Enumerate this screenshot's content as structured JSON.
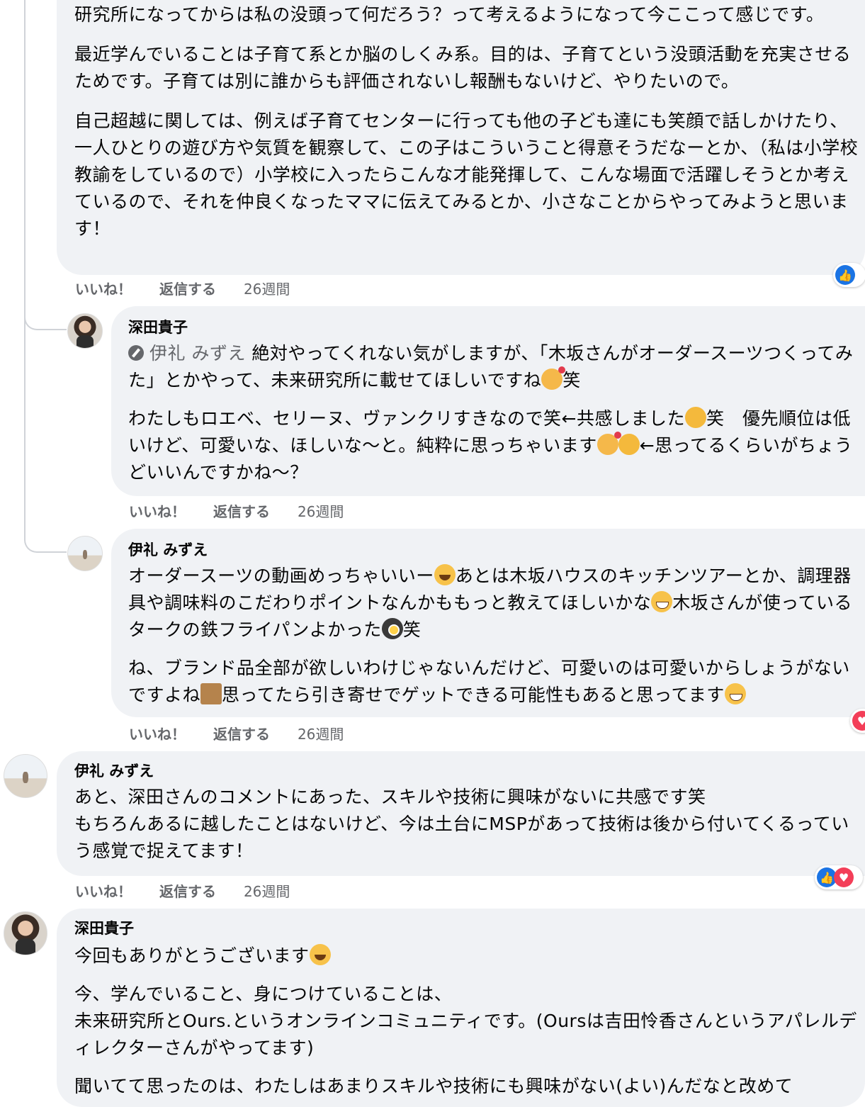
{
  "comments": [
    {
      "id": "c1",
      "paragraphs": [
        "研究所になってからは私の没頭って何だろう？って考えるようになって今ここって感じです。",
        "最近学んでいることは子育て系とか脳のしくみ系。目的は、子育てという没頭活動を充実させるためです。子育ては別に誰からも評価されないし報酬もないけど、やりたいので。",
        "自己超越に関しては、例えば子育てセンターに行っても他の子ども達にも笑顔で話しかけたり、一人ひとりの遊び方や気質を観察して、この子はこういうこと得意そうだなーとか、（私は小学校教諭をしているので）小学校に入ったらこんな才能発揮して、こんな場面で活躍しそうとか考えているので、それを仲良くなったママに伝えてみるとか、小さなことからやってみようと思います！"
      ],
      "actions": {
        "like": "いいね！",
        "reply": "返信する",
        "time": "26週間"
      }
    },
    {
      "id": "c2",
      "author": "深田貴子",
      "mention": "伊礼 みずえ",
      "p1_rest": " 絶対やってくれない気がしますが、「木坂さんがオーダースーツつくってみた」とかやって、未来研究所に載せてほしいですね",
      "p1_tail": "笑",
      "p2_a": "わたしもロエベ、セリーヌ、ヴァンクリすきなので笑←共感しました",
      "p2_b": "笑　優先順位は低いけど、可愛いな、ほしいな〜と。純粋に思っちゃいます",
      "p2_c": "←思ってるくらいがちょうどいいんですかね〜？",
      "actions": {
        "like": "いいね！",
        "reply": "返信する",
        "time": "26週間"
      }
    },
    {
      "id": "c3",
      "author": "伊礼 みずえ",
      "p1_a": "オーダースーツの動画めっちゃいいー",
      "p1_b": "あとは木坂ハウスのキッチンツアーとか、調理器具や調味料のこだわりポイントなんかももっと教えてほしいかな",
      "p1_c": "木坂さんが使っているタークの鉄フライパンよかった",
      "p1_d": "笑",
      "p2_a": "ね、ブランド品全部が欲しいわけじゃないんだけど、可愛いのは可愛いからしょうがないですよね",
      "p2_b": "思ってたら引き寄せでゲットできる可能性もあると思ってます",
      "actions": {
        "like": "いいね！",
        "reply": "返信する",
        "time": "26週間"
      }
    },
    {
      "id": "c4",
      "author": "伊礼 みずえ",
      "lines": [
        "あと、深田さんのコメントにあった、スキルや技術に興味がないに共感です笑",
        "もちろんあるに越したことはないけど、今は土台にMSPがあって技術は後から付いてくるっていう感覚で捉えてます！"
      ],
      "actions": {
        "like": "いいね！",
        "reply": "返信する",
        "time": "26週間"
      }
    },
    {
      "id": "c5",
      "author": "深田貴子",
      "p1": "今回もありがとうございます",
      "p2_l1": "今、学んでいること、身につけていることは、",
      "p2_l2": "未来研究所とOurs.というオンラインコミュニティです。(Oursは吉田怜香さんというアパレルディレクターさんがやってます)",
      "p3": "聞いてて思ったのは、わたしはあまりスキルや技術にも興味がない(よい)んだなと改めて"
    }
  ],
  "colors": {
    "bubble": "#f0f2f5",
    "meta": "#65676b",
    "like": "#1b74e4",
    "love": "#f33e58"
  }
}
